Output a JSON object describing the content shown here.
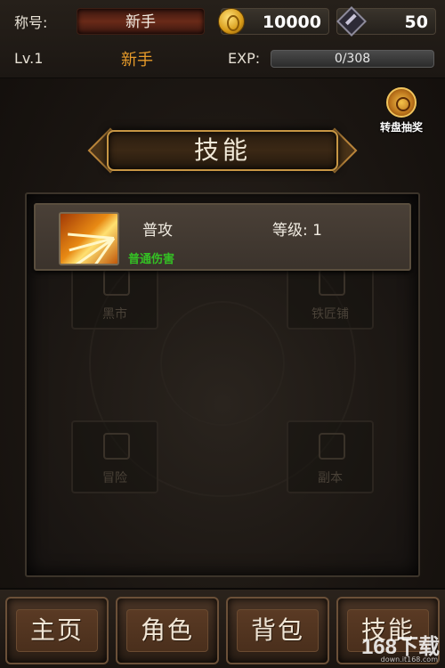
{
  "hud": {
    "title_label": "称号:",
    "title_value": "新手",
    "gold": "10000",
    "gems": "50",
    "level": "Lv.1",
    "rank": "新手",
    "exp_label": "EXP:",
    "exp_text": "0/308",
    "exp_fraction": 0
  },
  "lottery": {
    "label": "转盘抽奖"
  },
  "banner": {
    "title": "技能"
  },
  "background_tiles": [
    {
      "label": "黑市"
    },
    {
      "label": "铁匠铺"
    },
    {
      "label": "冒险"
    },
    {
      "label": "副本"
    }
  ],
  "skills": [
    {
      "name": "普攻",
      "level": "等级: 1",
      "desc": "普通伤害"
    }
  ],
  "nav": {
    "items": [
      "主页",
      "角色",
      "背包",
      "技能"
    ]
  },
  "watermark": {
    "big": "168下载",
    "small": "down.it168.com"
  },
  "colors": {
    "accent_orange": "#e79b2a",
    "desc_green": "#34c024",
    "panel_bg": "#1d1814"
  }
}
